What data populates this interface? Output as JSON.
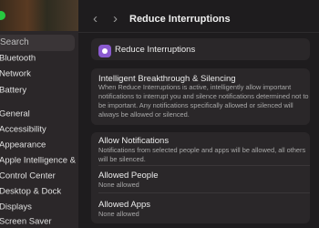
{
  "sidebar": {
    "search_placeholder": "Search",
    "items": [
      {
        "label": "Bluetooth",
        "color": "#2f7ef7"
      },
      {
        "label": "Network",
        "color": "#2f7ef7"
      },
      {
        "label": "Battery",
        "color": "#32c759"
      },
      {
        "label": "General",
        "color": "#8e8e93"
      },
      {
        "label": "Accessibility",
        "color": "#2f7ef7"
      },
      {
        "label": "Appearance",
        "color": "#1c1c1e"
      },
      {
        "label": "Apple Intelligence & Siri",
        "color": "#e05ad8"
      },
      {
        "label": "Control Center",
        "color": "#8e8e93"
      },
      {
        "label": "Desktop & Dock",
        "color": "#1c1c1e"
      },
      {
        "label": "Displays",
        "color": "#2f7ef7"
      },
      {
        "label": "Screen Saver",
        "color": "#3ab8d8"
      }
    ]
  },
  "header": {
    "back_icon": "chevron-left-icon",
    "forward_icon": "chevron-right-icon",
    "title": "Reduce Interruptions"
  },
  "focus_card": {
    "icon": "focus-icon",
    "label": "Reduce Interruptions"
  },
  "breakthrough_card": {
    "title": "Intelligent Breakthrough & Silencing",
    "description": "When Reduce Interruptions is active, intelligently allow important notifications to interrupt you and silence notifications determined not to be important. Any notifications specifically allowed or silenced will always be allowed or silenced."
  },
  "allow_card": {
    "allow_title": "Allow Notifications",
    "allow_desc": "Notifications from selected people and apps will be allowed, all others will be silenced.",
    "people_title": "Allowed People",
    "people_value": "None allowed",
    "apps_title": "Allowed Apps",
    "apps_value": "None allowed"
  }
}
